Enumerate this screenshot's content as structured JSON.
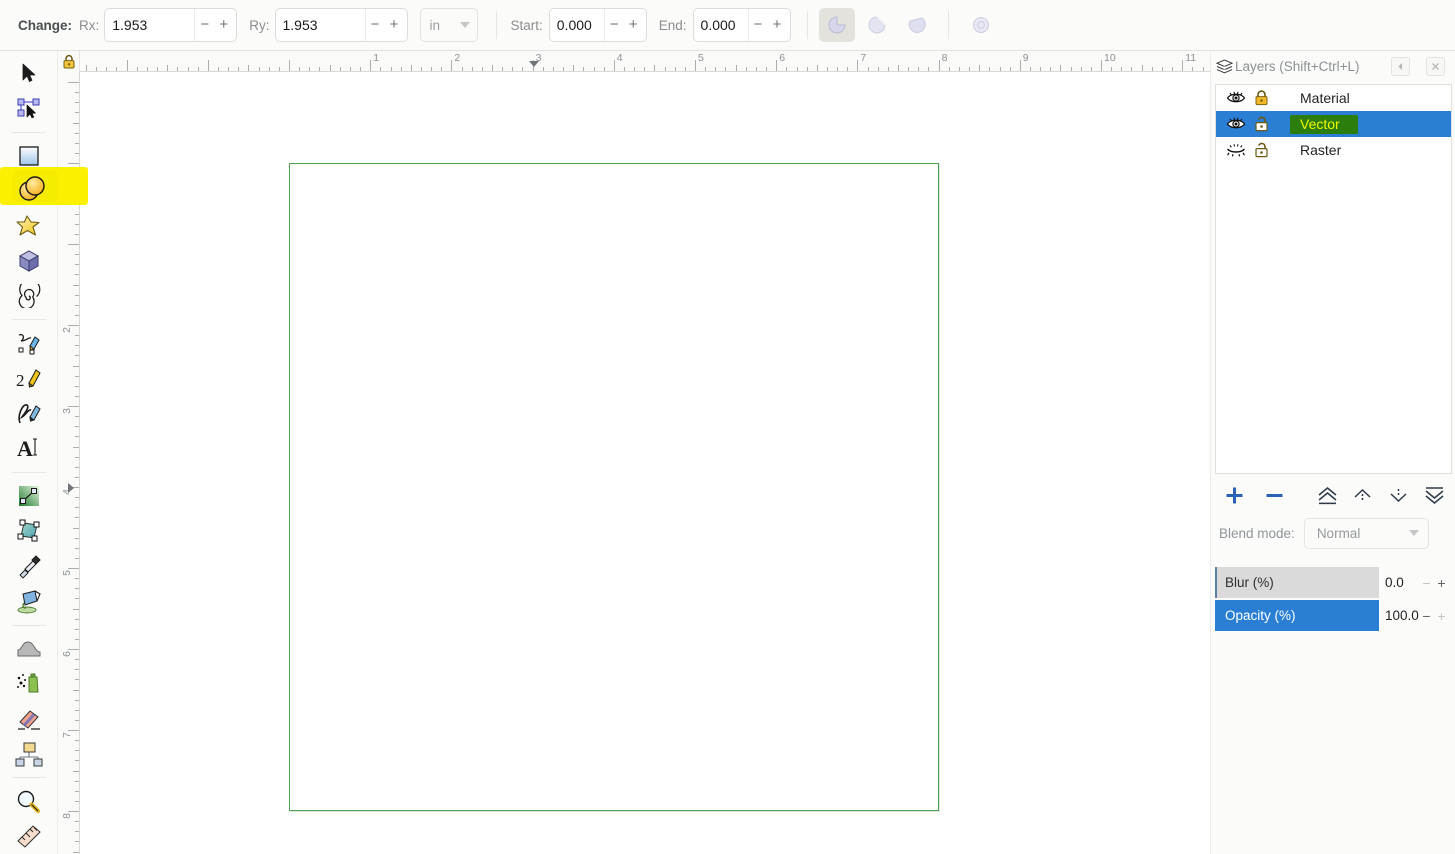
{
  "app": {
    "name": "Inkscape",
    "tool": "ellipse-arc-tool"
  },
  "toolbar": {
    "change_label": "Change:",
    "rx_label": "Rx:",
    "rx_value": "1.953",
    "ry_label": "Ry:",
    "ry_value": "1.953",
    "unit_value": "in",
    "start_label": "Start:",
    "start_value": "0.000",
    "end_label": "End:",
    "end_value": "0.000",
    "minus": "−",
    "plus": "+",
    "arc_modes": [
      {
        "name": "slice",
        "label": "Switch to slice (closed shape with two radii)",
        "active": true
      },
      {
        "name": "arc",
        "label": "Switch to arc (unclosed shape)",
        "active": false
      },
      {
        "name": "chord",
        "label": "Switch to chord (closed shape)",
        "active": false
      }
    ],
    "make_whole_label": "Make whole ellipse, not arc or segment"
  },
  "toolbox": {
    "tools": [
      {
        "name": "selector-tool",
        "label": "Selector tool",
        "selected": false
      },
      {
        "name": "node-tool",
        "label": "Node tool",
        "selected": false
      },
      {
        "name": "rectangle-tool",
        "label": "Rectangle tool",
        "selected": false
      },
      {
        "name": "ellipse-tool",
        "label": "Ellipse/arc tool",
        "selected": true
      },
      {
        "name": "star-tool",
        "label": "Star tool",
        "selected": false
      },
      {
        "name": "box3d-tool",
        "label": "3D box tool",
        "selected": false
      },
      {
        "name": "spiral-tool",
        "label": "Spiral tool",
        "selected": false
      },
      {
        "name": "pencil-tool",
        "label": "Pencil tool",
        "selected": false
      },
      {
        "name": "bezier-tool",
        "label": "Pen / Bezier tool",
        "selected": false
      },
      {
        "name": "calligraphy-tool",
        "label": "Calligraphy tool",
        "selected": false
      },
      {
        "name": "text-tool",
        "label": "Text tool",
        "selected": false
      },
      {
        "name": "gradient-tool",
        "label": "Gradient tool",
        "selected": false
      },
      {
        "name": "mesh-tool",
        "label": "Mesh gradient tool",
        "selected": false
      },
      {
        "name": "dropper-tool",
        "label": "Color picker / dropper tool",
        "selected": false
      },
      {
        "name": "paint-bucket-tool",
        "label": "Paint bucket tool",
        "selected": false
      },
      {
        "name": "tweak-tool",
        "label": "Tweak tool",
        "selected": false
      },
      {
        "name": "spray-tool",
        "label": "Spray tool",
        "selected": false
      },
      {
        "name": "eraser-tool",
        "label": "Eraser tool",
        "selected": false
      },
      {
        "name": "connector-tool",
        "label": "Connector tool",
        "selected": false
      },
      {
        "name": "zoom-tool",
        "label": "Zoom tool",
        "selected": false
      },
      {
        "name": "measure-tool",
        "label": "Measure tool",
        "selected": false
      }
    ]
  },
  "rulers": {
    "unit": "in",
    "horizontal_ticks": [
      "1",
      "2",
      "3",
      "4",
      "5",
      "6",
      "7",
      "8"
    ],
    "vertical_ticks": [
      "2",
      "3",
      "4",
      "5",
      "6",
      "7"
    ],
    "lock_icon": "lock-icon"
  },
  "layers_panel": {
    "title": "Layers (Shift+Ctrl+L)",
    "rows": [
      {
        "name": "Material",
        "visible": true,
        "locked": true,
        "selected": false
      },
      {
        "name": "Vector",
        "visible": true,
        "locked": false,
        "selected": true
      },
      {
        "name": "Raster",
        "visible": false,
        "locked": false,
        "selected": false
      }
    ],
    "buttons": [
      {
        "name": "add-layer-button",
        "glyph": "+"
      },
      {
        "name": "remove-layer-button",
        "glyph": "−"
      },
      {
        "name": "raise-to-top-button",
        "glyph": "raise-top-icon"
      },
      {
        "name": "raise-layer-button",
        "glyph": "raise-icon"
      },
      {
        "name": "lower-layer-button",
        "glyph": "lower-icon"
      },
      {
        "name": "lower-to-bottom-button",
        "glyph": "lower-bottom-icon"
      }
    ],
    "blend_mode_label": "Blend mode:",
    "blend_mode_value": "Normal",
    "blur_label": "Blur (%)",
    "blur_value": "0.0",
    "opacity_label": "Opacity (%)",
    "opacity_value": "100.0",
    "minus": "−",
    "plus": "+",
    "dock_buttons": [
      {
        "name": "dock-collapse-button",
        "glyph": "◀"
      },
      {
        "name": "dock-close-button",
        "glyph": "✕"
      }
    ]
  },
  "colors": {
    "page_border": "#4fa14f",
    "selection_blue": "#2a7fd4",
    "highlight_yellow": "#fbf000",
    "layer_highlight_green": "#2b7d0e",
    "opacity_slider_blue": "#2a7fd4"
  }
}
